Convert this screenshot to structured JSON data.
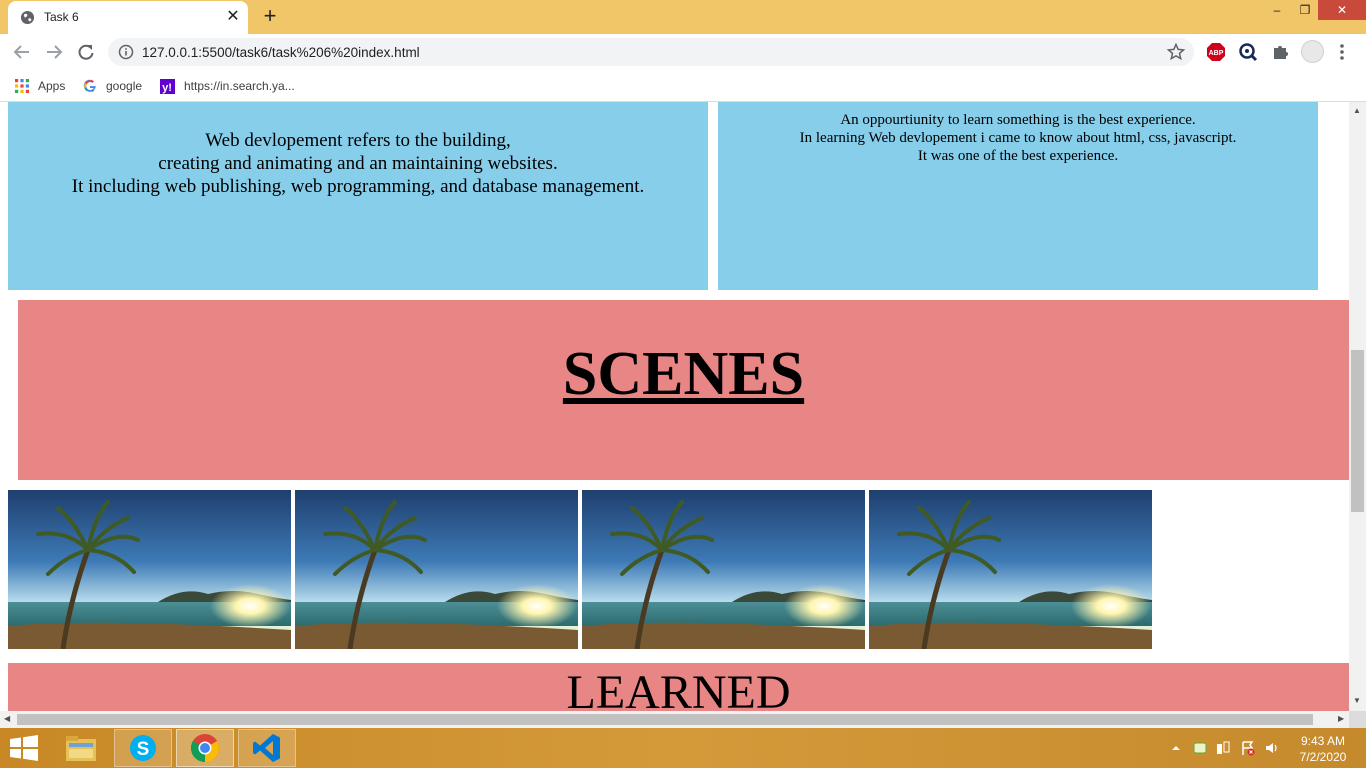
{
  "browser": {
    "tab_title": "Task 6",
    "close_glyph": "✕",
    "new_tab_glyph": "+",
    "window_controls": {
      "minimize": "–",
      "maximize": "❐",
      "close": "✕"
    },
    "address": "127.0.0.1:5500/task6/task%206%20index.html",
    "bookmarks": [
      {
        "label": "Apps",
        "icon": "apps-grid-icon"
      },
      {
        "label": "google",
        "icon": "google-icon"
      },
      {
        "label": "https://in.search.ya...",
        "icon": "yahoo-icon"
      }
    ],
    "extensions": [
      "adblock-plus-icon",
      "lens-icon",
      "puzzle-icon"
    ]
  },
  "page": {
    "intro_lines": [
      "Web devlopement refers to the building,",
      "creating and animating and an maintaining websites.",
      "It including web publishing, web programming, and database management."
    ],
    "experience_lines": [
      "An oppourtiunity to learn something is the best experience.",
      "In learning Web devlopement i came to know about html, css, javascript.",
      "It was one of the best experience."
    ],
    "scenes_heading": "SCENES",
    "scene_images": [
      {
        "name": "palm-beach-sunset-image"
      },
      {
        "name": "palm-beach-sunset-image"
      },
      {
        "name": "palm-beach-sunset-image"
      },
      {
        "name": "palm-beach-sunset-image"
      }
    ],
    "learned_heading": "LEARNED"
  },
  "taskbar": {
    "apps": [
      "file-explorer-icon",
      "skype-icon",
      "chrome-icon",
      "vscode-icon"
    ],
    "time": "9:43 AM",
    "date": "7/2/2020"
  },
  "colors": {
    "tabstrip": "#f0c668",
    "content_blue": "#87ceeb",
    "content_pink": "#e88585",
    "taskbar": "#c88826"
  }
}
